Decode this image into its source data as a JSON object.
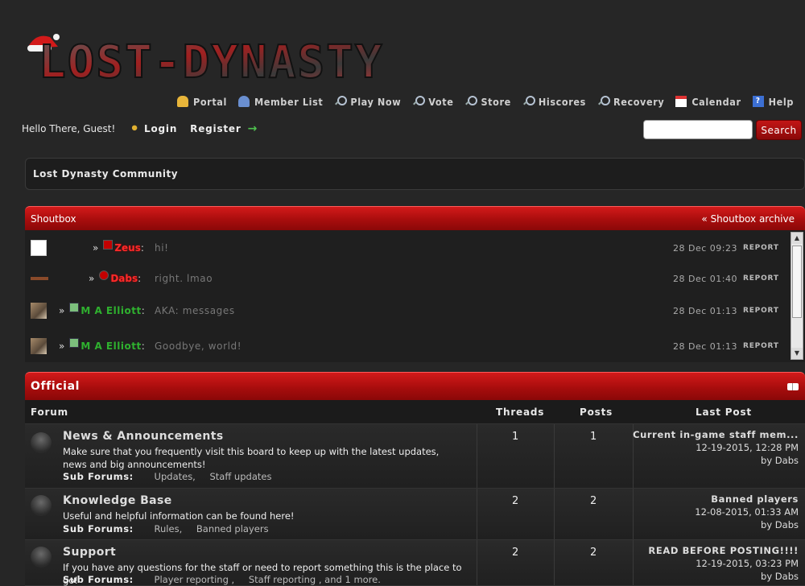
{
  "logo_text": "LOST-DYNASTY",
  "nav": [
    {
      "label": "Portal",
      "icon": "bell-icon"
    },
    {
      "label": "Member List",
      "icon": "users-icon"
    },
    {
      "label": "Play Now",
      "icon": "magnifier-icon"
    },
    {
      "label": "Vote",
      "icon": "magnifier-icon"
    },
    {
      "label": "Store",
      "icon": "magnifier-icon"
    },
    {
      "label": "Hiscores",
      "icon": "magnifier-icon"
    },
    {
      "label": "Recovery",
      "icon": "magnifier-icon"
    },
    {
      "label": "Calendar",
      "icon": "calendar-icon"
    },
    {
      "label": "Help",
      "icon": "help-icon"
    }
  ],
  "welcome": {
    "greeting": "Hello There, Guest!",
    "login": "Login",
    "register": "Register"
  },
  "search": {
    "placeholder": "",
    "button": "Search"
  },
  "breadcrumb": "Lost Dynasty Community",
  "shoutbox": {
    "title": "Shoutbox",
    "archive": "« Shoutbox archive",
    "report_label": "REPORT",
    "shouts": [
      {
        "user": "Zeus",
        "message": "hi!",
        "time": "28 Dec 09:23"
      },
      {
        "user": "Dabs",
        "message": "right. lmao",
        "time": "28 Dec 01:40"
      },
      {
        "user": "M A Elliott",
        "message": "AKA: messages",
        "time": "28 Dec 01:13"
      },
      {
        "user": "M A Elliott",
        "message": "Goodbye, world!",
        "time": "28 Dec 01:13"
      }
    ]
  },
  "category": {
    "title": "Official",
    "columns": {
      "forum": "Forum",
      "threads": "Threads",
      "posts": "Posts",
      "last_post": "Last Post"
    },
    "subforums_label": "Sub Forums:",
    "forums": [
      {
        "title": "News & Announcements",
        "description": "Make sure that you frequently visit this board to keep up with the latest updates, news and big announcements!",
        "subforums": [
          "Updates,",
          "Staff updates"
        ],
        "threads": "1",
        "posts": "1",
        "last_title": "Current in-game staff mem...",
        "last_date": "12-19-2015, 12:28 PM",
        "last_by": "by Dabs"
      },
      {
        "title": "Knowledge Base",
        "description": "Useful and helpful information can be found here!",
        "subforums": [
          "Rules,",
          "Banned players"
        ],
        "threads": "2",
        "posts": "2",
        "last_title": "Banned players",
        "last_date": "12-08-2015, 01:33 AM",
        "last_by": "by Dabs"
      },
      {
        "title": "Support",
        "description": "If you have any questions for the staff or need to report something this is the place to go!",
        "subforums": [
          "Player reporting ,",
          "Staff reporting , and 1 more."
        ],
        "threads": "2",
        "posts": "2",
        "last_title": "READ BEFORE POSTING!!!!",
        "last_date": "12-19-2015, 03:23 PM",
        "last_by": "by Dabs"
      }
    ]
  }
}
